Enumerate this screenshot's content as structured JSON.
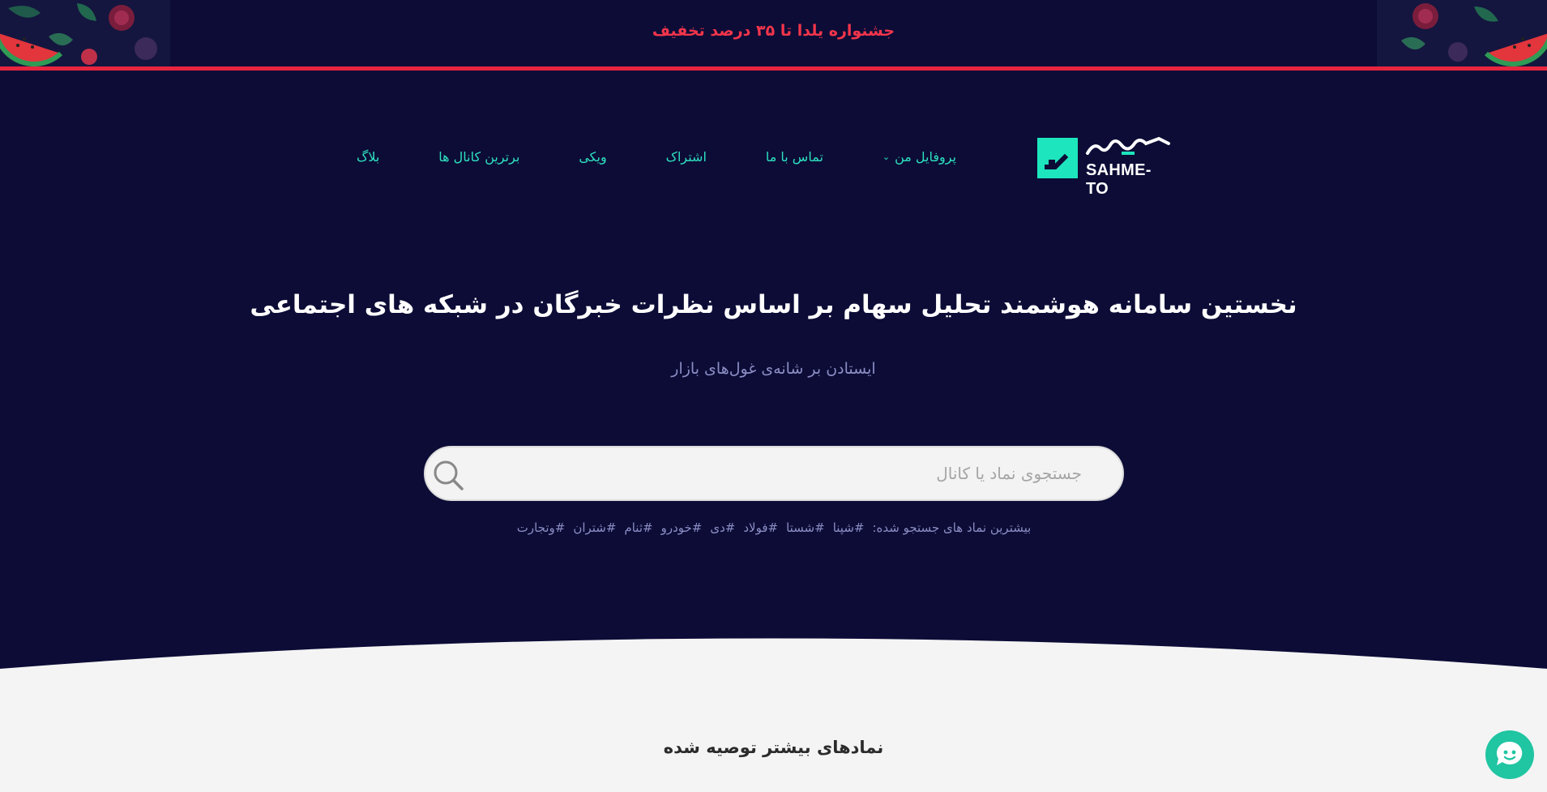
{
  "promo": {
    "text": "جشنواره یلدا تا ۳۵ درصد تخفیف"
  },
  "brand": {
    "wordmark": "SAHME-TO"
  },
  "nav": {
    "items": [
      {
        "label": "بلاگ"
      },
      {
        "label": "برترین کانال ها"
      },
      {
        "label": "ویکی"
      },
      {
        "label": "اشتراک"
      },
      {
        "label": "تماس با ما"
      },
      {
        "label": "پروفایل من",
        "has_dropdown": true,
        "chevron": "⌄"
      }
    ]
  },
  "hero": {
    "title": "نخستین سامانه هوشمند تحلیل سهام بر اساس نظرات خبرگان در شبکه های اجتماعی",
    "subtitle": "ایستادن بر شانه‌ی غول‌های بازار"
  },
  "search": {
    "placeholder": "جستجوی نماد یا کانال",
    "value": "",
    "icon": "search-icon"
  },
  "popular": {
    "label": "بیشترین نماد های جستجو شده:",
    "tags": [
      "#شپنا",
      "#شستا",
      "#فولاد",
      "#دی",
      "#خودرو",
      "#ثنام",
      "#شتران",
      "#وتجارت"
    ]
  },
  "section": {
    "title": "نمادهای بیشتر توصیه شده"
  },
  "colors": {
    "background": "#0c0c37",
    "accent": "#2ee0bf",
    "promo_red": "#f2354b",
    "light_section": "#f4f4f4",
    "chat": "#20c5a2"
  },
  "chat": {
    "icon": "chat-icon"
  }
}
